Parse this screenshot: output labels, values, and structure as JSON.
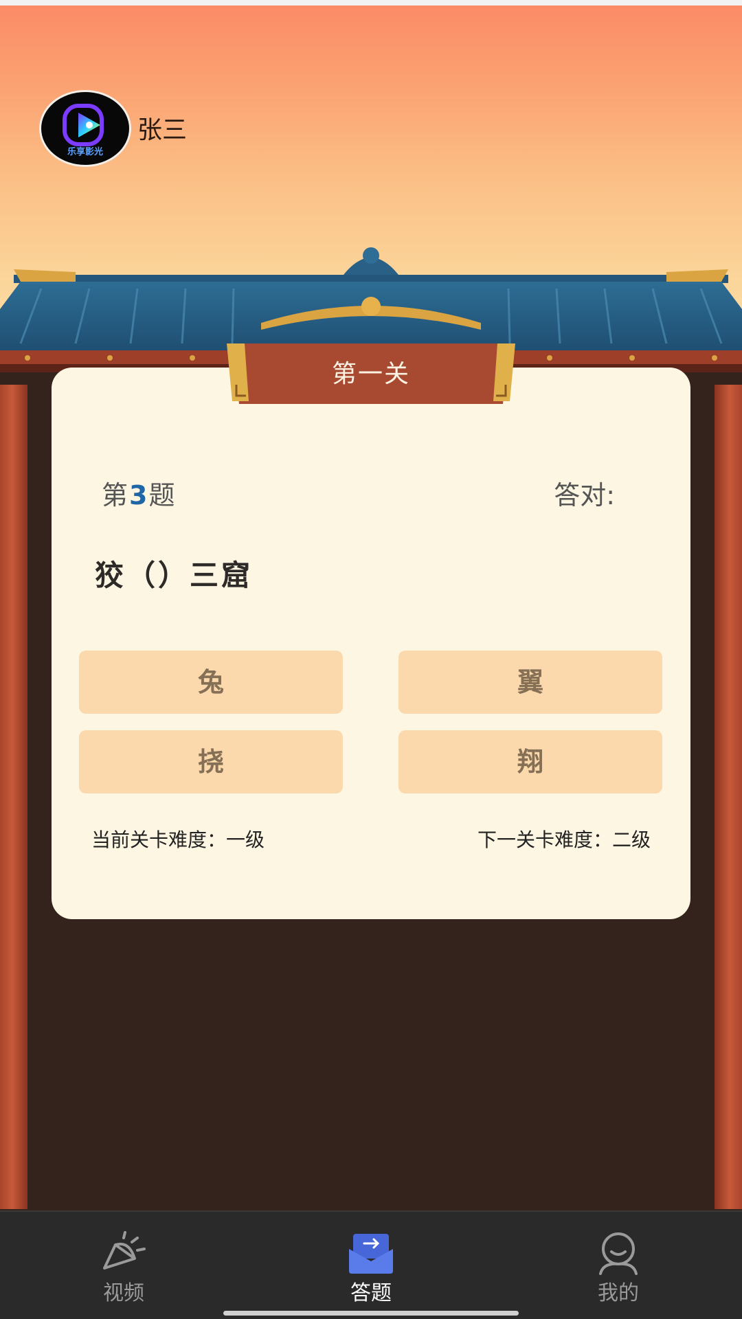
{
  "user": {
    "name": "张三",
    "avatar_text": "乐享影光"
  },
  "quiz": {
    "level_title": "第一关",
    "question_prefix": "第",
    "question_number": "3",
    "question_suffix": "题",
    "correct_label": "答对:",
    "question_text": "狡（）三窟",
    "options": [
      "兔",
      "翼",
      "挠",
      "翔"
    ],
    "current_difficulty": "当前关卡难度：一级",
    "next_difficulty": "下一关卡难度：二级"
  },
  "nav": {
    "items": [
      {
        "label": "视频",
        "icon": "video-cone-icon",
        "active": false
      },
      {
        "label": "答题",
        "icon": "quiz-envelope-icon",
        "active": true
      },
      {
        "label": "我的",
        "icon": "user-profile-icon",
        "active": false
      }
    ]
  },
  "colors": {
    "card_bg": "#fdf6e3",
    "option_bg": "#fbd9ad",
    "banner_red": "#a84a32",
    "accent_blue": "#1f66a6",
    "nav_active_icon": "#4767d8",
    "nav_bg": "#2a2a2a"
  }
}
